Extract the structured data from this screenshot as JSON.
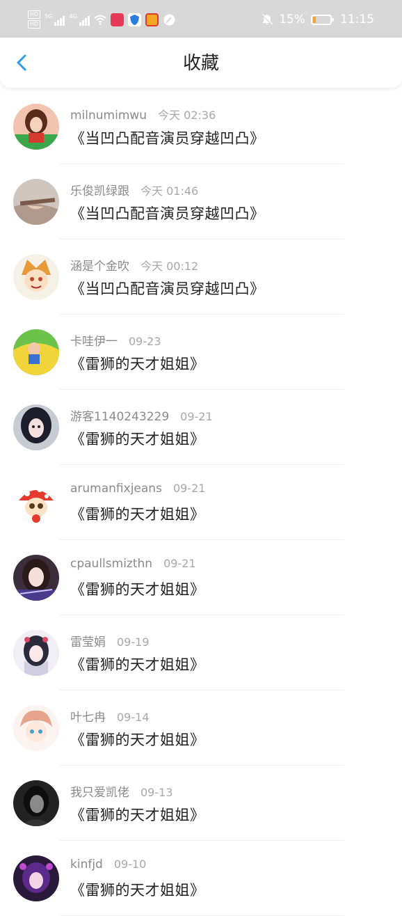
{
  "status_bar": {
    "hd_labels": [
      "HD",
      "HD"
    ],
    "network_labels": [
      "5G",
      "4G"
    ],
    "battery_percent_text": "15%",
    "battery_level": 0.15,
    "time": "11:15",
    "icons": [
      "signal-icon",
      "wifi-icon",
      "app-notification-icon",
      "shield-icon",
      "app-notification-icon",
      "browser-icon",
      "bell-off-icon",
      "battery-icon"
    ]
  },
  "header": {
    "title": "收藏",
    "back_icon": "chevron-left-icon",
    "accent_color": "#2a9df4"
  },
  "favorites": [
    {
      "user": "milnumimwu",
      "time": "今天 02:36",
      "work": "《当凹凸配音演员穿越凹凸》"
    },
    {
      "user": "乐俊凯绿跟",
      "time": "今天 01:46",
      "work": "《当凹凸配音演员穿越凹凸》"
    },
    {
      "user": "涵是个金吹",
      "time": "今天 00:12",
      "work": "《当凹凸配音演员穿越凹凸》"
    },
    {
      "user": "卡哇伊一",
      "time": "09-23",
      "work": "《雷狮的天才姐姐》"
    },
    {
      "user": "游客1140243229",
      "time": "09-21",
      "work": "《雷狮的天才姐姐》"
    },
    {
      "user": "arumanfixjeans",
      "time": "09-21",
      "work": "《雷狮的天才姐姐》"
    },
    {
      "user": "cpaullsmizthn",
      "time": "09-21",
      "work": "《雷狮的天才姐姐》"
    },
    {
      "user": "雷莹娟",
      "time": "09-19",
      "work": "《雷狮的天才姐姐》"
    },
    {
      "user": "叶七冉",
      "time": "09-14",
      "work": "《雷狮的天才姐姐》"
    },
    {
      "user": "我只爱凯佬",
      "time": "09-13",
      "work": "《雷狮的天才姐姐》"
    },
    {
      "user": "kinfjd",
      "time": "09-10",
      "work": "《雷狮的天才姐姐》"
    }
  ]
}
